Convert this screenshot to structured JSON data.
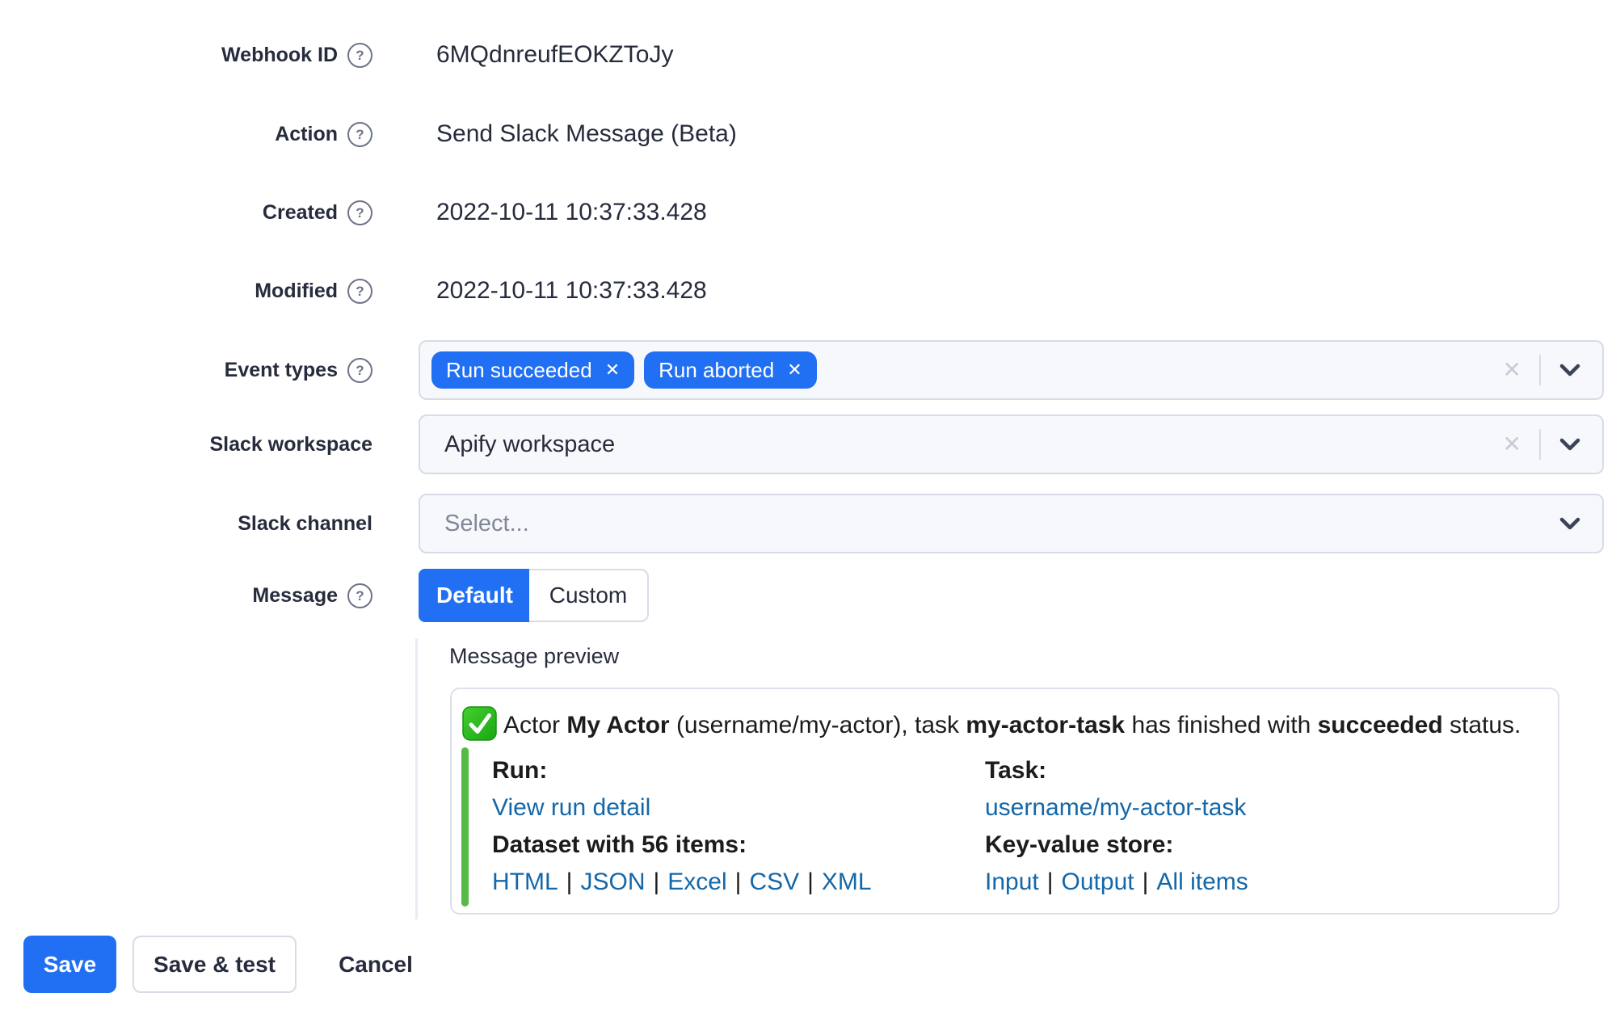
{
  "colors": {
    "accent": "#2170f3",
    "link": "#1467a8",
    "green_bar": "#56bb46",
    "emoji_green_light": "#44d02f",
    "emoji_green_dark": "#1aa613",
    "field_bg": "#f7f8fb"
  },
  "glyphs": {
    "help": "?",
    "remove": "✕",
    "clear": "✕",
    "link_separator": "|"
  },
  "form": {
    "rows": [
      {
        "label": "Webhook ID",
        "value": "6MQdnreufEOKZToJy"
      },
      {
        "label": "Action",
        "value": "Send Slack Message (Beta)"
      },
      {
        "label": "Created",
        "value": "2022-10-11 10:37:33.428"
      },
      {
        "label": "Modified",
        "value": "2022-10-11 10:37:33.428"
      }
    ],
    "event_types": {
      "label": "Event types",
      "tags": [
        "Run succeeded",
        "Run aborted"
      ]
    },
    "slack_workspace": {
      "label": "Slack workspace",
      "value": "Apify workspace"
    },
    "slack_channel": {
      "label": "Slack channel",
      "placeholder": "Select..."
    },
    "message": {
      "label": "Message",
      "options": [
        "Default",
        "Custom"
      ],
      "selected": "Default"
    }
  },
  "preview": {
    "title": "Message preview",
    "headline": [
      {
        "text": "Actor ",
        "bold": false
      },
      {
        "text": "My Actor",
        "bold": true
      },
      {
        "text": " (username/my-actor), task ",
        "bold": false
      },
      {
        "text": "my-actor-task",
        "bold": true
      },
      {
        "text": " has finished with ",
        "bold": false
      },
      {
        "text": "succeeded",
        "bold": true
      },
      {
        "text": " status.",
        "bold": false
      }
    ],
    "left_column": {
      "heading1": "Run:",
      "link1": "View run detail",
      "heading2": "Dataset with 56 items:",
      "links": [
        "HTML",
        "JSON",
        "Excel",
        "CSV",
        "XML"
      ]
    },
    "right_column": {
      "heading1": "Task:",
      "link1": "username/my-actor-task",
      "heading2": "Key-value store:",
      "links": [
        "Input",
        "Output",
        "All items"
      ]
    }
  },
  "actions": {
    "save": "Save",
    "save_and_test": "Save & test",
    "cancel": "Cancel"
  }
}
